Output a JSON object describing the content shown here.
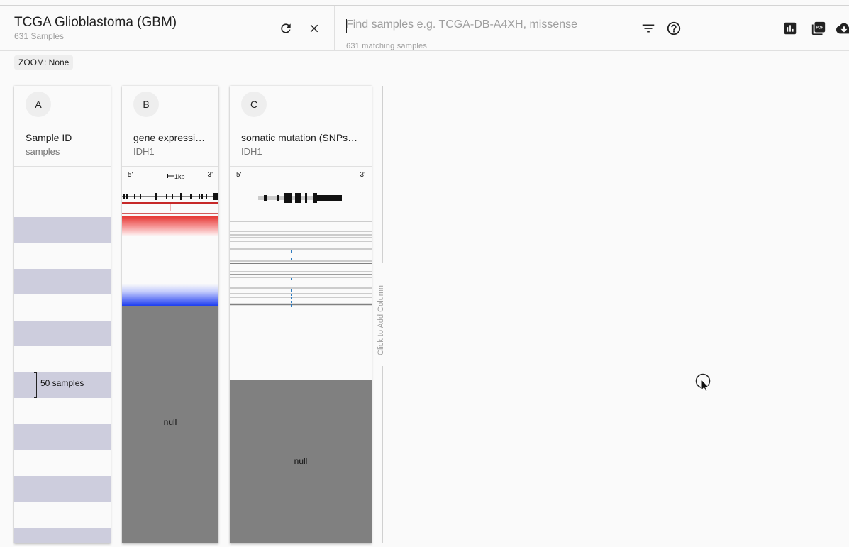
{
  "header": {
    "cohort_title": "TCGA Glioblastoma (GBM)",
    "sample_count": "631 Samples",
    "search_placeholder": "Find samples e.g. TCGA-DB-A4XH, missense",
    "match_count": "631 matching samples"
  },
  "icons": {
    "refresh": "refresh-icon",
    "close": "close-icon",
    "filter": "filter-icon",
    "help": "help-icon",
    "chart": "bar-chart-icon",
    "pdf": "pdf-icon",
    "cloud": "cloud-download-icon"
  },
  "zoom": {
    "label": "ZOOM: None"
  },
  "columns": [
    {
      "letter": "A",
      "title": "Sample ID",
      "subtitle": "samples",
      "annotation": "50 samples"
    },
    {
      "letter": "B",
      "title": "gene expressi…",
      "subtitle": "IDH1",
      "prime5": "5'",
      "prime3": "3'",
      "scale": "1kb",
      "null_label": "null"
    },
    {
      "letter": "C",
      "title": "somatic mutation (SNPs…",
      "subtitle": "IDH1",
      "prime5": "5'",
      "prime3": "3'",
      "null_label": "null"
    }
  ],
  "add_column": {
    "label": "Click to Add Column"
  },
  "colors": {
    "stripe": "#cdcddd",
    "null_gray": "#808080",
    "high_expr": "#e53935",
    "low_expr": "#1e3ef0",
    "mutation_blue": "#2e7bbf"
  }
}
